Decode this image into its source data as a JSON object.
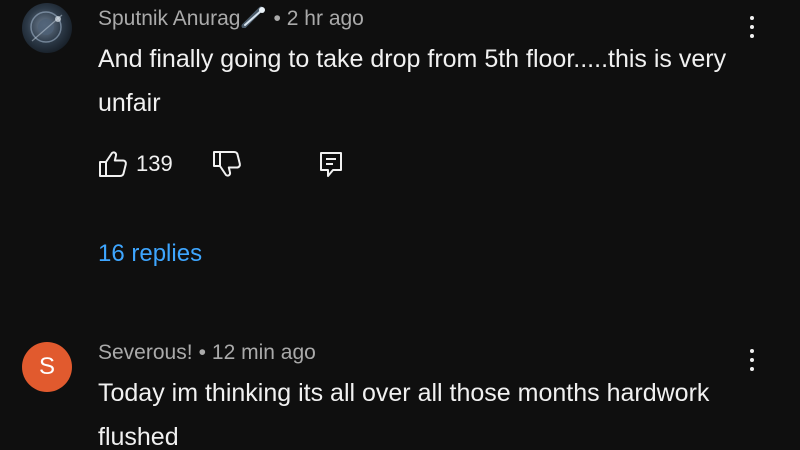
{
  "comments": [
    {
      "author": "Sputnik Anurag",
      "author_badge_icon": "comet-icon",
      "separator": "•",
      "time": "2 hr ago",
      "text": "And finally going to take drop from 5th floor.....this is very unfair",
      "likes": "139",
      "replies": "16 replies"
    },
    {
      "avatar_letter": "S",
      "avatar_color": "#e15a2e",
      "author": "Severous!",
      "separator": "•",
      "time": "12 min ago",
      "text": "Today im thinking its all over all those months hardwork flushed"
    }
  ],
  "colors": {
    "background": "#0f0f0f",
    "primary_text": "#f1f1f1",
    "secondary_text": "#aaaaaa",
    "link": "#3ea6ff"
  }
}
